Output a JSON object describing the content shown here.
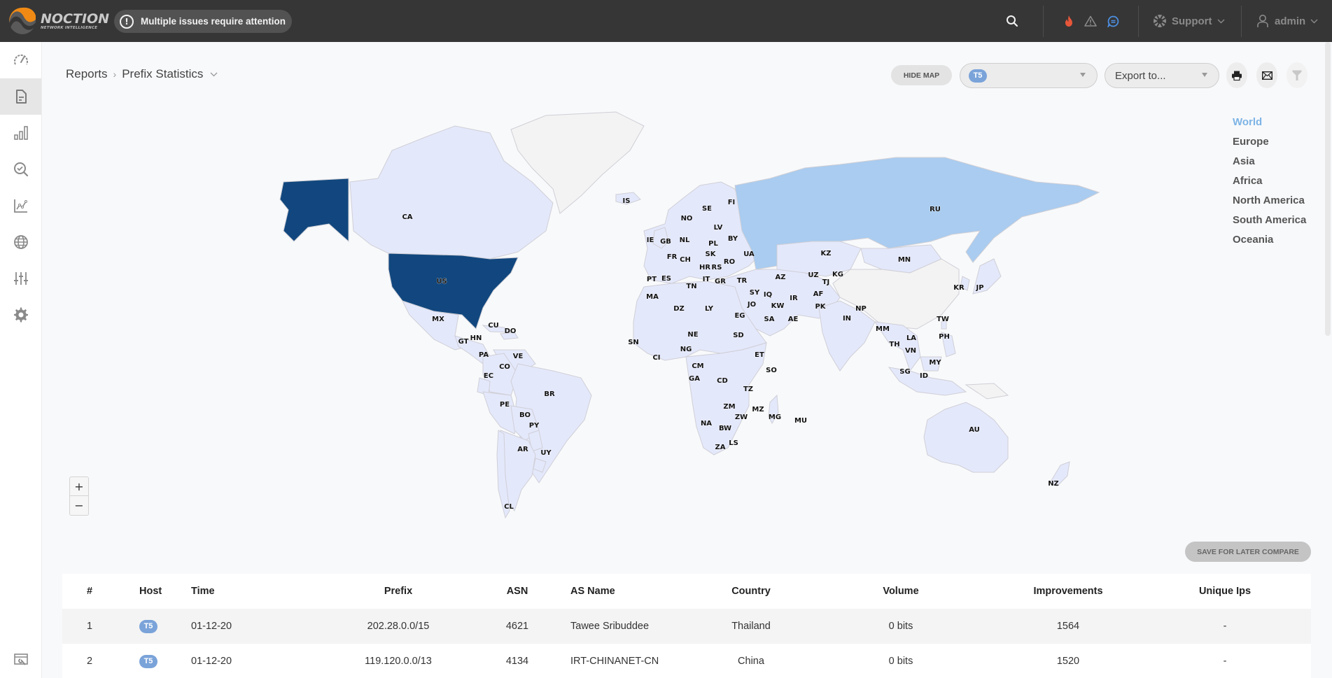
{
  "app": {
    "brand": "NOCTION",
    "brand_sub": "NETWORK INTELLIGENCE",
    "alert_text": "Multiple issues require attention"
  },
  "topbar": {
    "icons": [
      "search-icon",
      "fire-icon",
      "warning-icon",
      "chat-icon"
    ],
    "support_label": "Support",
    "user_label": "admin",
    "colors": {
      "fire": "#e8563a",
      "chat": "#4d8fe0",
      "bar_bg": "#363636"
    }
  },
  "sidebar": {
    "items": [
      {
        "name": "dashboard",
        "icon": "speedometer-icon",
        "active": false
      },
      {
        "name": "reports",
        "icon": "document-icon",
        "active": true
      },
      {
        "name": "statistics",
        "icon": "bar-chart-icon",
        "active": false
      },
      {
        "name": "troubleshooting",
        "icon": "search-check-icon",
        "active": false
      },
      {
        "name": "graphs",
        "icon": "line-chart-icon",
        "active": false
      },
      {
        "name": "global",
        "icon": "globe-icon",
        "active": false
      },
      {
        "name": "configuration",
        "icon": "sliders-icon",
        "active": false
      },
      {
        "name": "settings",
        "icon": "gear-icon",
        "active": false
      }
    ],
    "bottom_icon": "maintenance-icon"
  },
  "breadcrumb": {
    "parent": "Reports",
    "current": "Prefix Statistics"
  },
  "toolbar": {
    "hide_map_label": "HIDE MAP",
    "host_selected": "T5",
    "export_placeholder": "Export to...",
    "icons": [
      "print-icon",
      "email-icon",
      "filter-icon"
    ]
  },
  "map": {
    "regions": [
      "World",
      "Europe",
      "Asia",
      "Africa",
      "North America",
      "South America",
      "Oceania"
    ],
    "active_region": "World",
    "zoom_in": "+",
    "zoom_out": "−",
    "colors": {
      "high": "#11477e",
      "medium": "#a9ccf0",
      "low": "#e4e8fb",
      "none": "#f3f3f3",
      "border": "#cfcfd6"
    },
    "country_levels": {
      "US": "high",
      "RU": "medium",
      "CA": "low",
      "MX": "low",
      "CU": "low",
      "DO": "low",
      "GT": "low",
      "HN": "low",
      "PA": "low",
      "VE": "low",
      "CO": "low",
      "EC": "low",
      "PE": "low",
      "BR": "low",
      "BO": "low",
      "PY": "low",
      "AR": "low",
      "UY": "low",
      "CL": "low",
      "IS": "low",
      "NO": "low",
      "SE": "low",
      "FI": "low",
      "LV": "low",
      "BY": "low",
      "IE": "low",
      "GB": "low",
      "NL": "low",
      "PL": "low",
      "FR": "low",
      "CH": "low",
      "SK": "low",
      "UA": "low",
      "HR": "low",
      "RS": "low",
      "RO": "low",
      "PT": "low",
      "ES": "low",
      "IT": "low",
      "GR": "low",
      "TR": "low",
      "TN": "low",
      "MA": "low",
      "DZ": "low",
      "LY": "low",
      "EG": "low",
      "SY": "low",
      "IQ": "low",
      "JO": "low",
      "KW": "low",
      "SA": "low",
      "AE": "low",
      "IR": "low",
      "AZ": "low",
      "KZ": "low",
      "UZ": "low",
      "KG": "low",
      "TJ": "low",
      "AF": "low",
      "PK": "low",
      "IN": "low",
      "NP": "low",
      "MN": "low",
      "KR": "low",
      "JP": "low",
      "TW": "low",
      "PH": "low",
      "MM": "low",
      "TH": "low",
      "LA": "low",
      "VN": "low",
      "MY": "low",
      "SG": "low",
      "ID": "low",
      "AU": "low",
      "NZ": "low",
      "SN": "low",
      "CI": "low",
      "NE": "low",
      "NG": "low",
      "CM": "low",
      "GA": "low",
      "SD": "low",
      "ET": "low",
      "SO": "low",
      "CD": "low",
      "TZ": "low",
      "ZM": "low",
      "MZ": "low",
      "ZW": "low",
      "MG": "low",
      "MU": "low",
      "NA": "low",
      "BW": "low",
      "ZA": "low",
      "LS": "low"
    }
  },
  "save_compare_label": "SAVE FOR LATER COMPARE",
  "table": {
    "columns": [
      "#",
      "Host",
      "Time",
      "Prefix",
      "ASN",
      "AS Name",
      "Country",
      "Volume",
      "Improvements",
      "Unique Ips"
    ],
    "rows": [
      {
        "index": "1",
        "host": "T5",
        "time": "01-12-20",
        "prefix": "202.28.0.0/15",
        "asn": "4621",
        "as_name": "Tawee Sribuddee",
        "country": "Thailand",
        "volume": "0 bits",
        "improvements": "1564",
        "unique_ips": "-"
      },
      {
        "index": "2",
        "host": "T5",
        "time": "01-12-20",
        "prefix": "119.120.0.0/13",
        "asn": "4134",
        "as_name": "IRT-CHINANET-CN",
        "country": "China",
        "volume": "0 bits",
        "improvements": "1520",
        "unique_ips": "-"
      }
    ]
  }
}
